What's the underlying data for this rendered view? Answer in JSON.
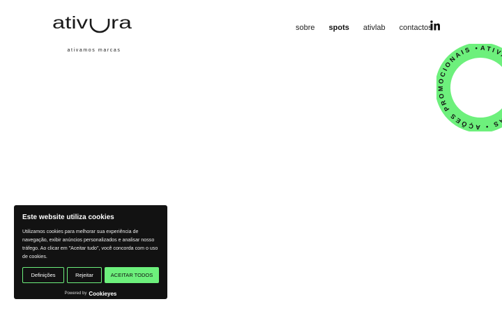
{
  "brand": {
    "name": "ativ",
    "name_end": "ra",
    "tagline": "ativamos marcas"
  },
  "nav": {
    "items": [
      {
        "label": "sobre",
        "active": false
      },
      {
        "label": "spots",
        "active": true
      },
      {
        "label": "ativlab",
        "active": false
      },
      {
        "label": "contactos",
        "active": false
      }
    ],
    "social_icon": "linkedin-icon"
  },
  "badge": {
    "text": "ATIVAÇÃO DE MARCAS • AÇÕES PROMOCIONAIS •",
    "color": "#6df07c"
  },
  "cookie_banner": {
    "title": "Este website utiliza cookies",
    "text": "Utilizamos cookies para melhorar sua experiência de navegação, exibir anúncios personalizados e analisar nosso tráfego. Ao clicar em \"Aceitar tudo\", você concorda com o uso de cookies.",
    "buttons": {
      "settings": "Definições",
      "reject": "Rejeitar",
      "accept": "ACEITAR TODOS"
    },
    "powered_by": "Powered by",
    "powered_brand": "Cookieyes",
    "accent_color": "#6df07c",
    "background_color": "#121212"
  }
}
